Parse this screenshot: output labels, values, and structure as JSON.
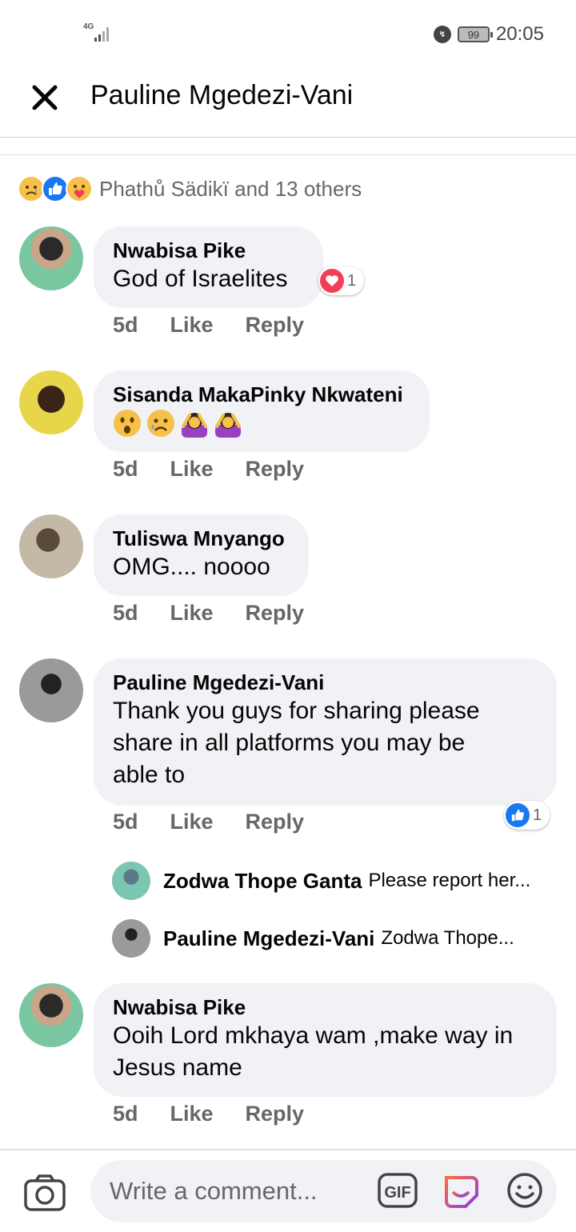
{
  "status_bar": {
    "network": "4G",
    "battery": "99",
    "time": "20:05"
  },
  "header": {
    "title": "Pauline Mgedezi-Vani"
  },
  "reactions_summary": {
    "icons": [
      "sad-reaction-icon",
      "like-reaction-icon",
      "care-reaction-icon"
    ],
    "text": "Phathů Sädikï and 13 others"
  },
  "comments": [
    {
      "name": "Nwabisa Pike",
      "text": "God of Israelites",
      "time": "5d",
      "like": "Like",
      "reply": "Reply",
      "reaction": {
        "icon": "love-reaction-icon",
        "count": "1"
      }
    },
    {
      "name": "Sisanda MakaPinky Nkwateni",
      "text": "",
      "emojis": [
        "astonished-emoji",
        "sad-sweat-emoji",
        "woman-gesturing-emoji",
        "woman-gesturing-emoji"
      ],
      "time": "5d",
      "like": "Like",
      "reply": "Reply"
    },
    {
      "name": "Tuliswa Mnyango",
      "text": "OMG.... noooo",
      "time": "5d",
      "like": "Like",
      "reply": "Reply"
    },
    {
      "name": "Pauline Mgedezi-Vani",
      "text_lines": [
        "Thank you guys for sharing please",
        "share in all platforms you may be",
        "able to"
      ],
      "time": "5d",
      "like": "Like",
      "reply": "Reply",
      "reaction": {
        "icon": "like-reaction-icon",
        "count": "1"
      },
      "replies": [
        {
          "name": "Zodwa Thope Ganta",
          "text": "Please report her..."
        },
        {
          "name": "Pauline Mgedezi-Vani",
          "text": "Zodwa Thope..."
        }
      ]
    },
    {
      "name": "Nwabisa Pike",
      "text_lines": [
        "Ooih Lord mkhaya wam ,make way in",
        "Jesus name"
      ],
      "time": "5d",
      "like": "Like",
      "reply": "Reply"
    }
  ],
  "composer": {
    "placeholder": "Write a comment...",
    "gif_label": "GIF"
  },
  "colors": {
    "bubble": "#f0f2f5",
    "meta_text": "#65676b",
    "like_blue": "#1877f2",
    "love_red": "#f33e58"
  }
}
